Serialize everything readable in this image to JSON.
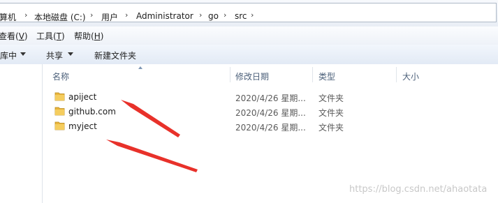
{
  "breadcrumb": {
    "items": [
      "算机",
      "本地磁盘 (C:)",
      "用户",
      "Administrator",
      "go",
      "src"
    ]
  },
  "menubar": {
    "items": [
      {
        "label": "查看",
        "key": "V"
      },
      {
        "label": "工具",
        "key": "T"
      },
      {
        "label": "帮助",
        "key": "H"
      }
    ]
  },
  "toolbar": {
    "include_label": "库中",
    "share_label": "共享",
    "new_folder_label": "新建文件夹"
  },
  "columns": {
    "name": "名称",
    "date": "修改日期",
    "type": "类型",
    "size": "大小"
  },
  "files": [
    {
      "name": "apiject",
      "date": "2020/4/26 星期...",
      "type": "文件夹"
    },
    {
      "name": "github.com",
      "date": "2020/4/26 星期...",
      "type": "文件夹"
    },
    {
      "name": "myject",
      "date": "2020/4/26 星期...",
      "type": "文件夹"
    }
  ],
  "watermark": "https://blog.csdn.net/ahaotata",
  "colors": {
    "annotation_arrow": "#e8312a",
    "folder": "#e9b53d"
  }
}
